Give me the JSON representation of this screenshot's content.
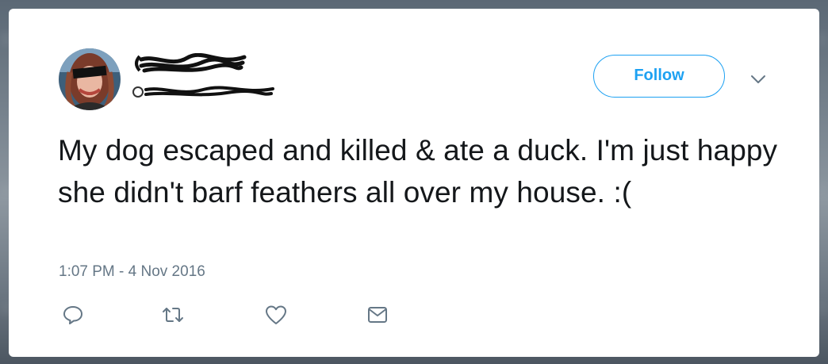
{
  "tweet": {
    "text": "My dog escaped and killed & ate a duck. I'm just happy she didn't barf feathers all over my house. :(",
    "timestamp": "1:07 PM - 4 Nov 2016"
  },
  "author": {
    "name_redacted": true,
    "handle_redacted": true
  },
  "header": {
    "follow_label": "Follow",
    "menu_icon": "chevron-down-icon"
  },
  "actions": {
    "icons": [
      "reply-icon",
      "retweet-icon",
      "like-icon",
      "direct-message-icon"
    ]
  },
  "colors": {
    "accent": "#1da1f2",
    "text": "#14171a",
    "secondary_text": "#657786",
    "icon": "#657786"
  }
}
